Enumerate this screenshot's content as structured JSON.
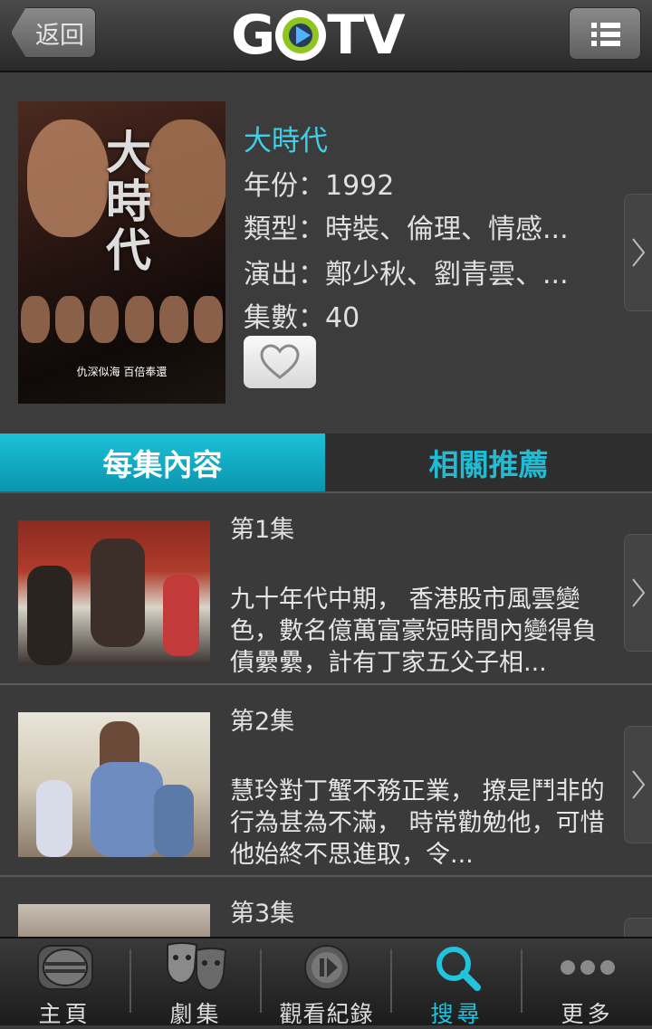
{
  "header": {
    "back_label": "返回",
    "logo_text_left": "G",
    "logo_text_right": "TV"
  },
  "show": {
    "title": "大時代",
    "year": "年份：1992",
    "genre": "類型：時裝、倫理、情感...",
    "cast": "演出：鄭少秋、劉青雲、...",
    "episodes_count": "集數：40",
    "poster_title": "大時代",
    "poster_caption": "仇深似海 百倍奉還"
  },
  "tabs": {
    "episodes": "每集內容",
    "related": "相關推薦"
  },
  "episodes": [
    {
      "title": "第1集",
      "desc": "九十年代中期， 香港股市風雲變色，數名億萬富豪短時間內變得負債纍纍，計有丁家五父子相..."
    },
    {
      "title": "第2集",
      "desc": "慧玲對丁蟹不務正業， 撩是鬥非的行為甚為不滿， 時常勸勉他，可惜他始終不思進取，令..."
    },
    {
      "title": "第3集",
      "desc": ""
    }
  ],
  "nav": {
    "home": "主頁",
    "drama": "劇集",
    "history": "觀看紀錄",
    "search": "搜尋",
    "more": "更多"
  },
  "colors": {
    "accent": "#21c4dc",
    "background": "#3a3a3a"
  },
  "icons": [
    "home-icon",
    "drama-masks-icon",
    "history-replay-icon",
    "search-icon",
    "more-dots-icon",
    "heart-icon",
    "chevron-right-icon",
    "list-menu-icon"
  ]
}
